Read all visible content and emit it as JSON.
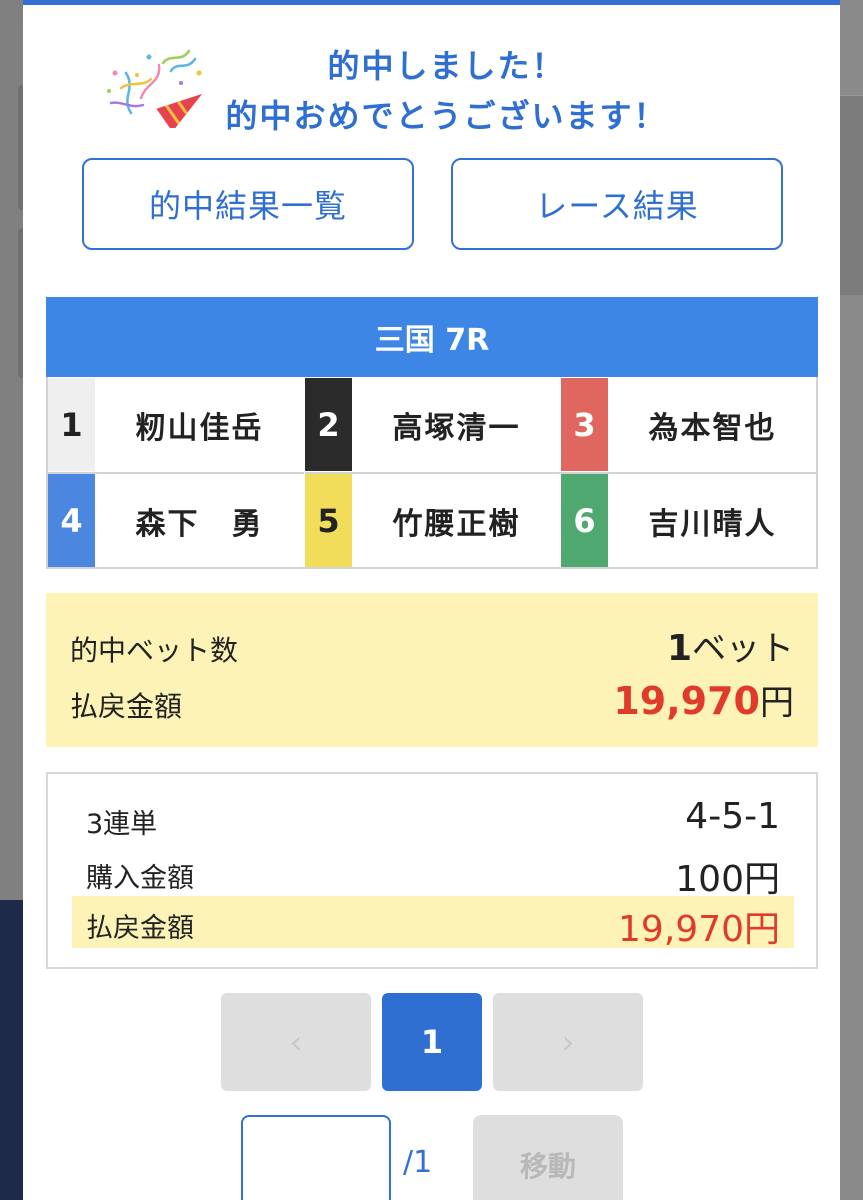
{
  "congrats": {
    "line1": "的中しました！",
    "line2": "的中おめでとうございます！",
    "icon": "party-popper-icon"
  },
  "buttons": {
    "hit_list": "的中結果一覧",
    "race_result": "レース結果"
  },
  "race": {
    "title": "三国 7R",
    "racers": [
      {
        "num": "1",
        "name": "籾山佳岳",
        "bg": "#efefef",
        "fg": "#222222"
      },
      {
        "num": "2",
        "name": "高塚清一",
        "bg": "#2b2b2b",
        "fg": "#ffffff"
      },
      {
        "num": "3",
        "name": "為本智也",
        "bg": "#e0675f",
        "fg": "#ffffff"
      },
      {
        "num": "4",
        "name": "森下　勇",
        "bg": "#4b86e0",
        "fg": "#ffffff"
      },
      {
        "num": "5",
        "name": "竹腰正樹",
        "bg": "#f1dd5a",
        "fg": "#222222"
      },
      {
        "num": "6",
        "name": "吉川晴人",
        "bg": "#4fa870",
        "fg": "#ffffff"
      }
    ]
  },
  "summary": {
    "hit_count_label": "的中ベット数",
    "hit_count_value": "1",
    "hit_count_unit": "ベット",
    "payout_label": "払戻金額",
    "payout_value": "19,970",
    "payout_unit": "円"
  },
  "detail": {
    "bet_type_label": "3連単",
    "bet_type_value": "4-5-1",
    "purchase_label": "購入金額",
    "purchase_value": "100円",
    "payout_label": "払戻金額",
    "payout_value": "19,970円"
  },
  "pager": {
    "prev": "‹",
    "current": "1",
    "next": "›"
  },
  "jump": {
    "input_value": "",
    "total": "/1",
    "button": "移動"
  },
  "colors": {
    "accent": "#3370d6",
    "header_bg": "#3d86e6",
    "highlight_bg": "#fdf3b6",
    "payout_red": "#e03b2a"
  }
}
